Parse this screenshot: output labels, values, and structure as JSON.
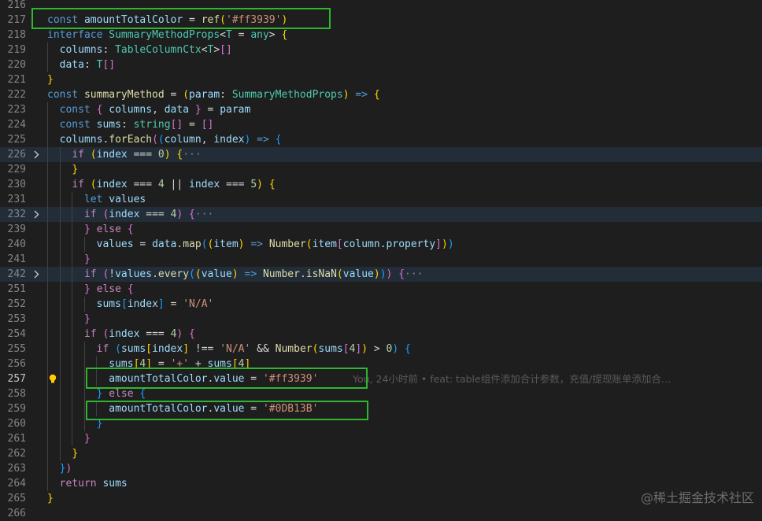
{
  "lines": [
    {
      "num": "216",
      "fold": false,
      "code": []
    },
    {
      "num": "217",
      "fold": false,
      "code": [
        [
          "kw",
          "const "
        ],
        [
          "var",
          "amountTotalColor"
        ],
        [
          "op",
          " = "
        ],
        [
          "fn",
          "ref"
        ],
        [
          "br1",
          "("
        ],
        [
          "str",
          "'#ff3939'"
        ],
        [
          "br1",
          ")"
        ]
      ]
    },
    {
      "num": "218",
      "fold": false,
      "code": [
        [
          "kw",
          "interface "
        ],
        [
          "ty",
          "SummaryMethodProps"
        ],
        [
          "op",
          "<"
        ],
        [
          "ty",
          "T"
        ],
        [
          "op",
          " = "
        ],
        [
          "ty",
          "any"
        ],
        [
          "op",
          "> "
        ],
        [
          "br1",
          "{"
        ]
      ]
    },
    {
      "num": "219",
      "fold": false,
      "code": [
        [
          "op",
          "  "
        ],
        [
          "var",
          "columns"
        ],
        [
          "op",
          ": "
        ],
        [
          "ty",
          "TableColumnCtx"
        ],
        [
          "op",
          "<"
        ],
        [
          "ty",
          "T"
        ],
        [
          "op",
          ">"
        ],
        [
          "br2",
          "[]"
        ]
      ]
    },
    {
      "num": "220",
      "fold": false,
      "code": [
        [
          "op",
          "  "
        ],
        [
          "var",
          "data"
        ],
        [
          "op",
          ": "
        ],
        [
          "ty",
          "T"
        ],
        [
          "br2",
          "[]"
        ]
      ]
    },
    {
      "num": "221",
      "fold": false,
      "code": [
        [
          "br1",
          "}"
        ]
      ]
    },
    {
      "num": "222",
      "fold": false,
      "code": [
        [
          "kw",
          "const "
        ],
        [
          "fn",
          "summaryMethod"
        ],
        [
          "op",
          " = "
        ],
        [
          "br1",
          "("
        ],
        [
          "var",
          "param"
        ],
        [
          "op",
          ": "
        ],
        [
          "ty",
          "SummaryMethodProps"
        ],
        [
          "br1",
          ")"
        ],
        [
          "kw",
          " => "
        ],
        [
          "br1",
          "{"
        ]
      ]
    },
    {
      "num": "223",
      "fold": false,
      "code": [
        [
          "op",
          "  "
        ],
        [
          "kw",
          "const "
        ],
        [
          "br2",
          "{ "
        ],
        [
          "var",
          "columns"
        ],
        [
          "op",
          ", "
        ],
        [
          "var",
          "data"
        ],
        [
          "br2",
          " }"
        ],
        [
          "op",
          " = "
        ],
        [
          "var",
          "param"
        ]
      ]
    },
    {
      "num": "224",
      "fold": false,
      "code": [
        [
          "op",
          "  "
        ],
        [
          "kw",
          "const "
        ],
        [
          "var",
          "sums"
        ],
        [
          "op",
          ": "
        ],
        [
          "ty",
          "string"
        ],
        [
          "br2",
          "[]"
        ],
        [
          "op",
          " = "
        ],
        [
          "br2",
          "[]"
        ]
      ]
    },
    {
      "num": "225",
      "fold": false,
      "code": [
        [
          "op",
          "  "
        ],
        [
          "var",
          "columns"
        ],
        [
          "op",
          "."
        ],
        [
          "fn",
          "forEach"
        ],
        [
          "br2",
          "("
        ],
        [
          "br3",
          "("
        ],
        [
          "var",
          "column"
        ],
        [
          "op",
          ", "
        ],
        [
          "var",
          "index"
        ],
        [
          "br3",
          ")"
        ],
        [
          "kw",
          " => "
        ],
        [
          "br3",
          "{"
        ]
      ]
    },
    {
      "num": "226",
      "fold": true,
      "code": [
        [
          "op",
          "    "
        ],
        [
          "ctl",
          "if "
        ],
        [
          "br1",
          "("
        ],
        [
          "var",
          "index"
        ],
        [
          "op",
          " === "
        ],
        [
          "num",
          "0"
        ],
        [
          "br1",
          ")"
        ],
        [
          "op",
          " "
        ],
        [
          "br1",
          "{"
        ],
        [
          "ell",
          "···"
        ]
      ]
    },
    {
      "num": "229",
      "fold": false,
      "code": [
        [
          "op",
          "    "
        ],
        [
          "br1",
          "}"
        ]
      ]
    },
    {
      "num": "230",
      "fold": false,
      "code": [
        [
          "op",
          "    "
        ],
        [
          "ctl",
          "if "
        ],
        [
          "br1",
          "("
        ],
        [
          "var",
          "index"
        ],
        [
          "op",
          " === "
        ],
        [
          "num",
          "4"
        ],
        [
          "op",
          " || "
        ],
        [
          "var",
          "index"
        ],
        [
          "op",
          " === "
        ],
        [
          "num",
          "5"
        ],
        [
          "br1",
          ")"
        ],
        [
          "op",
          " "
        ],
        [
          "br1",
          "{"
        ]
      ]
    },
    {
      "num": "231",
      "fold": false,
      "code": [
        [
          "op",
          "      "
        ],
        [
          "kw",
          "let "
        ],
        [
          "var",
          "values"
        ]
      ]
    },
    {
      "num": "232",
      "fold": true,
      "code": [
        [
          "op",
          "      "
        ],
        [
          "ctl",
          "if "
        ],
        [
          "br2",
          "("
        ],
        [
          "var",
          "index"
        ],
        [
          "op",
          " === "
        ],
        [
          "num",
          "4"
        ],
        [
          "br2",
          ")"
        ],
        [
          "op",
          " "
        ],
        [
          "br2",
          "{"
        ],
        [
          "ell",
          "···"
        ]
      ]
    },
    {
      "num": "239",
      "fold": false,
      "code": [
        [
          "op",
          "      "
        ],
        [
          "br2",
          "}"
        ],
        [
          "ctl",
          " else "
        ],
        [
          "br2",
          "{"
        ]
      ]
    },
    {
      "num": "240",
      "fold": false,
      "code": [
        [
          "op",
          "        "
        ],
        [
          "var",
          "values"
        ],
        [
          "op",
          " = "
        ],
        [
          "var",
          "data"
        ],
        [
          "op",
          "."
        ],
        [
          "fn",
          "map"
        ],
        [
          "br3",
          "("
        ],
        [
          "br1",
          "("
        ],
        [
          "var",
          "item"
        ],
        [
          "br1",
          ")"
        ],
        [
          "kw",
          " => "
        ],
        [
          "fn",
          "Number"
        ],
        [
          "br1",
          "("
        ],
        [
          "var",
          "item"
        ],
        [
          "br2",
          "["
        ],
        [
          "var",
          "column"
        ],
        [
          "op",
          "."
        ],
        [
          "var",
          "property"
        ],
        [
          "br2",
          "]"
        ],
        [
          "br1",
          ")"
        ],
        [
          "br3",
          ")"
        ]
      ]
    },
    {
      "num": "241",
      "fold": false,
      "code": [
        [
          "op",
          "      "
        ],
        [
          "br2",
          "}"
        ]
      ]
    },
    {
      "num": "242",
      "fold": true,
      "code": [
        [
          "op",
          "      "
        ],
        [
          "ctl",
          "if "
        ],
        [
          "br2",
          "("
        ],
        [
          "op",
          "!"
        ],
        [
          "var",
          "values"
        ],
        [
          "op",
          "."
        ],
        [
          "fn",
          "every"
        ],
        [
          "br3",
          "("
        ],
        [
          "br1",
          "("
        ],
        [
          "var",
          "value"
        ],
        [
          "br1",
          ")"
        ],
        [
          "kw",
          " => "
        ],
        [
          "fn",
          "Number"
        ],
        [
          "op",
          "."
        ],
        [
          "fn",
          "isNaN"
        ],
        [
          "br1",
          "("
        ],
        [
          "var",
          "value"
        ],
        [
          "br1",
          ")"
        ],
        [
          "br3",
          ")"
        ],
        [
          "br2",
          ")"
        ],
        [
          "op",
          " "
        ],
        [
          "br2",
          "{"
        ],
        [
          "ell",
          "···"
        ]
      ]
    },
    {
      "num": "251",
      "fold": false,
      "code": [
        [
          "op",
          "      "
        ],
        [
          "br2",
          "}"
        ],
        [
          "ctl",
          " else "
        ],
        [
          "br2",
          "{"
        ]
      ]
    },
    {
      "num": "252",
      "fold": false,
      "code": [
        [
          "op",
          "        "
        ],
        [
          "var",
          "sums"
        ],
        [
          "br3",
          "["
        ],
        [
          "var",
          "index"
        ],
        [
          "br3",
          "]"
        ],
        [
          "op",
          " = "
        ],
        [
          "str",
          "'N/A'"
        ]
      ]
    },
    {
      "num": "253",
      "fold": false,
      "code": [
        [
          "op",
          "      "
        ],
        [
          "br2",
          "}"
        ]
      ]
    },
    {
      "num": "254",
      "fold": false,
      "code": [
        [
          "op",
          "      "
        ],
        [
          "ctl",
          "if "
        ],
        [
          "br2",
          "("
        ],
        [
          "var",
          "index"
        ],
        [
          "op",
          " === "
        ],
        [
          "num",
          "4"
        ],
        [
          "br2",
          ")"
        ],
        [
          "op",
          " "
        ],
        [
          "br2",
          "{"
        ]
      ]
    },
    {
      "num": "255",
      "fold": false,
      "code": [
        [
          "op",
          "        "
        ],
        [
          "ctl",
          "if "
        ],
        [
          "br3",
          "("
        ],
        [
          "var",
          "sums"
        ],
        [
          "br1",
          "["
        ],
        [
          "var",
          "index"
        ],
        [
          "br1",
          "]"
        ],
        [
          "op",
          " !== "
        ],
        [
          "str",
          "'N/A'"
        ],
        [
          "op",
          " && "
        ],
        [
          "fn",
          "Number"
        ],
        [
          "br1",
          "("
        ],
        [
          "var",
          "sums"
        ],
        [
          "br2",
          "["
        ],
        [
          "num",
          "4"
        ],
        [
          "br2",
          "]"
        ],
        [
          "br1",
          ")"
        ],
        [
          "op",
          " > "
        ],
        [
          "num",
          "0"
        ],
        [
          "br3",
          ")"
        ],
        [
          "op",
          " "
        ],
        [
          "br3",
          "{"
        ]
      ]
    },
    {
      "num": "256",
      "fold": false,
      "code": [
        [
          "op",
          "          "
        ],
        [
          "var",
          "sums"
        ],
        [
          "br1",
          "["
        ],
        [
          "num",
          "4"
        ],
        [
          "br1",
          "]"
        ],
        [
          "op",
          " = "
        ],
        [
          "str",
          "'+'"
        ],
        [
          "op",
          " + "
        ],
        [
          "var",
          "sums"
        ],
        [
          "br1",
          "["
        ],
        [
          "num",
          "4"
        ],
        [
          "br1",
          "]"
        ]
      ]
    },
    {
      "num": "257",
      "fold": false,
      "code": [
        [
          "op",
          "          "
        ],
        [
          "var",
          "amountTotalColor"
        ],
        [
          "op",
          "."
        ],
        [
          "var",
          "value"
        ],
        [
          "op",
          " = "
        ],
        [
          "str",
          "'#ff3939'"
        ]
      ]
    },
    {
      "num": "258",
      "fold": false,
      "code": [
        [
          "op",
          "        "
        ],
        [
          "br3",
          "}"
        ],
        [
          "ctl",
          " else "
        ],
        [
          "br3",
          "{"
        ]
      ]
    },
    {
      "num": "259",
      "fold": false,
      "code": [
        [
          "op",
          "          "
        ],
        [
          "var",
          "amountTotalColor"
        ],
        [
          "op",
          "."
        ],
        [
          "var",
          "value"
        ],
        [
          "op",
          " = "
        ],
        [
          "str",
          "'#0DB13B'"
        ]
      ]
    },
    {
      "num": "260",
      "fold": false,
      "code": [
        [
          "op",
          "        "
        ],
        [
          "br3",
          "}"
        ]
      ]
    },
    {
      "num": "261",
      "fold": false,
      "code": [
        [
          "op",
          "      "
        ],
        [
          "br2",
          "}"
        ]
      ]
    },
    {
      "num": "262",
      "fold": false,
      "code": [
        [
          "op",
          "    "
        ],
        [
          "br1",
          "}"
        ]
      ]
    },
    {
      "num": "263",
      "fold": false,
      "code": [
        [
          "op",
          "  "
        ],
        [
          "br3",
          "}"
        ],
        [
          "br2",
          ")"
        ]
      ]
    },
    {
      "num": "264",
      "fold": false,
      "code": [
        [
          "op",
          "  "
        ],
        [
          "ctl",
          "return "
        ],
        [
          "var",
          "sums"
        ]
      ]
    },
    {
      "num": "265",
      "fold": false,
      "code": [
        [
          "br1",
          "}"
        ]
      ]
    },
    {
      "num": "266",
      "fold": false,
      "code": []
    }
  ],
  "highlighted_lines": [
    "226",
    "232",
    "242"
  ],
  "current_line": "257",
  "blame": {
    "line": "257",
    "text": "You, 24小时前 • feat: table组件添加合计参数，充值/提现账单添加合…"
  },
  "watermark": "@稀土掘金技术社区",
  "colors": {
    "background": "#1e1e1e",
    "annotation_box": "#2fb62f",
    "keyword": "#569cd6",
    "string": "#ce9178",
    "function": "#dcdcaa",
    "type": "#4ec9b0",
    "variable": "#9cdcfe"
  },
  "icons": {
    "fold": "chevron-right-icon",
    "lightbulb": "lightbulb-icon"
  }
}
